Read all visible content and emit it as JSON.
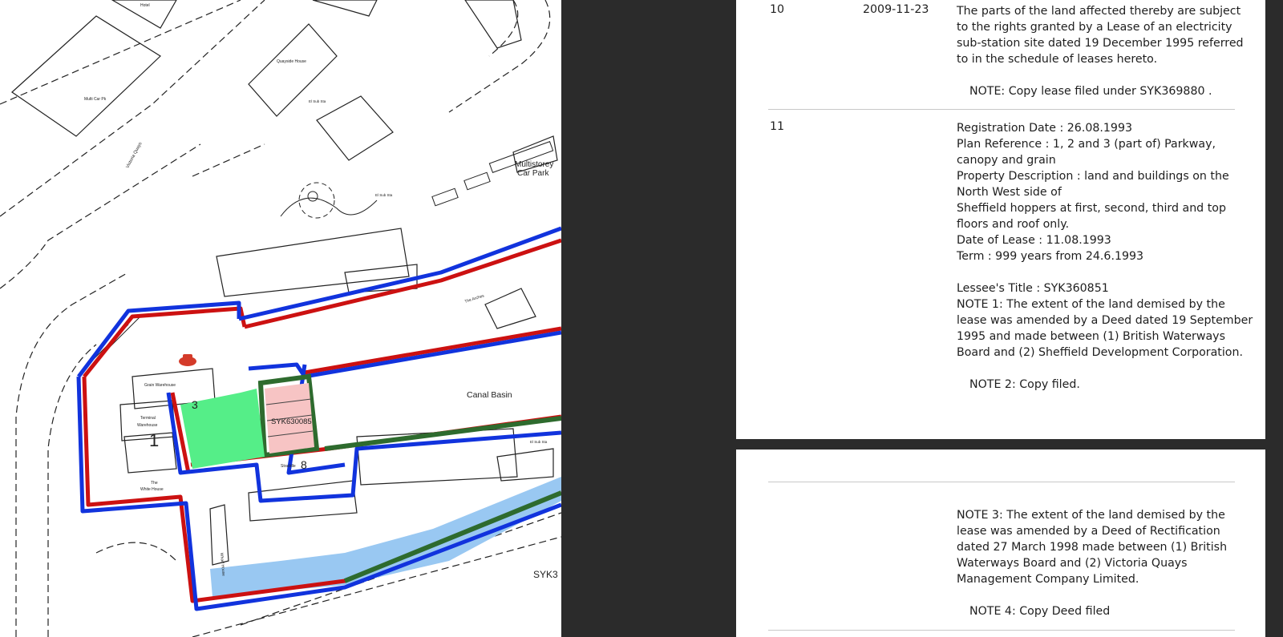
{
  "map": {
    "labels": {
      "hotel": "Hotel",
      "multi_car_pk": "Multi Car Pk",
      "quayside_house": "Quayside House",
      "el_sub_sta_1": "El Sub Sta",
      "el_sub_sta_2": "El Sub Sta",
      "el_sub_sta_3": "El Sub Sta",
      "multistorey_1": "Multistorey",
      "multistorey_2": "Car Park",
      "the_arches": "The Arches",
      "grain_warehouse": "Grain Warehouse",
      "terminal_1": "Terminal",
      "terminal_2": "Warehouse",
      "the_white_house_1": "The",
      "the_white_house_2": "White House",
      "straddle": "Straddle",
      "canal_basin": "Canal Basin",
      "title_number": "SYK630085",
      "title_number_2": "SYK3",
      "wharf_house": "Wharf House",
      "victoria_quays_road": "Victoria Quays",
      "plan_1": "1",
      "plan_3": "3",
      "plan_8": "8"
    },
    "colors": {
      "red_edging": "#cc1111",
      "blue_edging": "#1133dd",
      "green_edging": "#2e6b2e",
      "green_fill": "#55ee88",
      "pink_fill": "#f7c4c4",
      "water_fill": "#99c8f2"
    }
  },
  "register": {
    "entries": [
      {
        "number": "10",
        "date": "2009-11-23",
        "lines": [
          "The parts of the land affected thereby are subject",
          "to the rights granted by a Lease of an electricity",
          "sub-station site dated 19 December 1995 referred",
          "to in the schedule of leases hereto."
        ],
        "note": "NOTE: Copy lease filed under SYK369880 ."
      },
      {
        "number": "11",
        "date": "",
        "lines": [
          "Registration Date    : 26.08.1993",
          "Plan Reference       : 1, 2 and 3 (part of) Parkway,",
          "canopy and grain",
          "Property Description  : land and buildings on the",
          "North West side of",
          "Sheffield hoppers at first, second, third and top",
          "floors and roof only.",
          "Date of Lease       : 11.08.1993",
          "Term                  : 999 years from 24.6.1993",
          "",
          "Lessee's Title      : SYK360851",
          "NOTE 1: The extent of the land demised by the",
          "lease was amended by a Deed dated 19 September",
          "1995 and made between (1) British Waterways",
          "Board and (2) Sheffield Development Corporation."
        ],
        "note": "NOTE 2: Copy filed."
      }
    ],
    "continuation": {
      "lines": [
        "NOTE 3: The extent of the land demised by the",
        "lease was amended by a Deed of Rectification",
        "dated 27 March 1998 made between (1) British",
        "Waterways Board and (2) Victoria Quays",
        "Management Company Limited."
      ],
      "note": "NOTE 4: Copy Deed filed"
    }
  }
}
